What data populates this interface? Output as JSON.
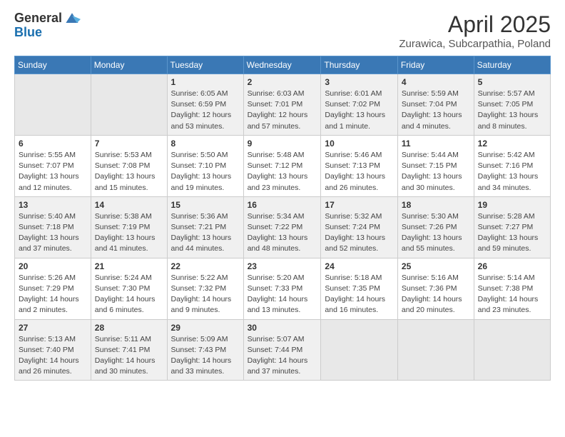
{
  "logo": {
    "general": "General",
    "blue": "Blue"
  },
  "title": "April 2025",
  "location": "Zurawica, Subcarpathia, Poland",
  "days_of_week": [
    "Sunday",
    "Monday",
    "Tuesday",
    "Wednesday",
    "Thursday",
    "Friday",
    "Saturday"
  ],
  "weeks": [
    [
      {
        "day": "",
        "info": ""
      },
      {
        "day": "",
        "info": ""
      },
      {
        "day": "1",
        "info": "Sunrise: 6:05 AM\nSunset: 6:59 PM\nDaylight: 12 hours\nand 53 minutes."
      },
      {
        "day": "2",
        "info": "Sunrise: 6:03 AM\nSunset: 7:01 PM\nDaylight: 12 hours\nand 57 minutes."
      },
      {
        "day": "3",
        "info": "Sunrise: 6:01 AM\nSunset: 7:02 PM\nDaylight: 13 hours\nand 1 minute."
      },
      {
        "day": "4",
        "info": "Sunrise: 5:59 AM\nSunset: 7:04 PM\nDaylight: 13 hours\nand 4 minutes."
      },
      {
        "day": "5",
        "info": "Sunrise: 5:57 AM\nSunset: 7:05 PM\nDaylight: 13 hours\nand 8 minutes."
      }
    ],
    [
      {
        "day": "6",
        "info": "Sunrise: 5:55 AM\nSunset: 7:07 PM\nDaylight: 13 hours\nand 12 minutes."
      },
      {
        "day": "7",
        "info": "Sunrise: 5:53 AM\nSunset: 7:08 PM\nDaylight: 13 hours\nand 15 minutes."
      },
      {
        "day": "8",
        "info": "Sunrise: 5:50 AM\nSunset: 7:10 PM\nDaylight: 13 hours\nand 19 minutes."
      },
      {
        "day": "9",
        "info": "Sunrise: 5:48 AM\nSunset: 7:12 PM\nDaylight: 13 hours\nand 23 minutes."
      },
      {
        "day": "10",
        "info": "Sunrise: 5:46 AM\nSunset: 7:13 PM\nDaylight: 13 hours\nand 26 minutes."
      },
      {
        "day": "11",
        "info": "Sunrise: 5:44 AM\nSunset: 7:15 PM\nDaylight: 13 hours\nand 30 minutes."
      },
      {
        "day": "12",
        "info": "Sunrise: 5:42 AM\nSunset: 7:16 PM\nDaylight: 13 hours\nand 34 minutes."
      }
    ],
    [
      {
        "day": "13",
        "info": "Sunrise: 5:40 AM\nSunset: 7:18 PM\nDaylight: 13 hours\nand 37 minutes."
      },
      {
        "day": "14",
        "info": "Sunrise: 5:38 AM\nSunset: 7:19 PM\nDaylight: 13 hours\nand 41 minutes."
      },
      {
        "day": "15",
        "info": "Sunrise: 5:36 AM\nSunset: 7:21 PM\nDaylight: 13 hours\nand 44 minutes."
      },
      {
        "day": "16",
        "info": "Sunrise: 5:34 AM\nSunset: 7:22 PM\nDaylight: 13 hours\nand 48 minutes."
      },
      {
        "day": "17",
        "info": "Sunrise: 5:32 AM\nSunset: 7:24 PM\nDaylight: 13 hours\nand 52 minutes."
      },
      {
        "day": "18",
        "info": "Sunrise: 5:30 AM\nSunset: 7:26 PM\nDaylight: 13 hours\nand 55 minutes."
      },
      {
        "day": "19",
        "info": "Sunrise: 5:28 AM\nSunset: 7:27 PM\nDaylight: 13 hours\nand 59 minutes."
      }
    ],
    [
      {
        "day": "20",
        "info": "Sunrise: 5:26 AM\nSunset: 7:29 PM\nDaylight: 14 hours\nand 2 minutes."
      },
      {
        "day": "21",
        "info": "Sunrise: 5:24 AM\nSunset: 7:30 PM\nDaylight: 14 hours\nand 6 minutes."
      },
      {
        "day": "22",
        "info": "Sunrise: 5:22 AM\nSunset: 7:32 PM\nDaylight: 14 hours\nand 9 minutes."
      },
      {
        "day": "23",
        "info": "Sunrise: 5:20 AM\nSunset: 7:33 PM\nDaylight: 14 hours\nand 13 minutes."
      },
      {
        "day": "24",
        "info": "Sunrise: 5:18 AM\nSunset: 7:35 PM\nDaylight: 14 hours\nand 16 minutes."
      },
      {
        "day": "25",
        "info": "Sunrise: 5:16 AM\nSunset: 7:36 PM\nDaylight: 14 hours\nand 20 minutes."
      },
      {
        "day": "26",
        "info": "Sunrise: 5:14 AM\nSunset: 7:38 PM\nDaylight: 14 hours\nand 23 minutes."
      }
    ],
    [
      {
        "day": "27",
        "info": "Sunrise: 5:13 AM\nSunset: 7:40 PM\nDaylight: 14 hours\nand 26 minutes."
      },
      {
        "day": "28",
        "info": "Sunrise: 5:11 AM\nSunset: 7:41 PM\nDaylight: 14 hours\nand 30 minutes."
      },
      {
        "day": "29",
        "info": "Sunrise: 5:09 AM\nSunset: 7:43 PM\nDaylight: 14 hours\nand 33 minutes."
      },
      {
        "day": "30",
        "info": "Sunrise: 5:07 AM\nSunset: 7:44 PM\nDaylight: 14 hours\nand 37 minutes."
      },
      {
        "day": "",
        "info": ""
      },
      {
        "day": "",
        "info": ""
      },
      {
        "day": "",
        "info": ""
      }
    ]
  ]
}
